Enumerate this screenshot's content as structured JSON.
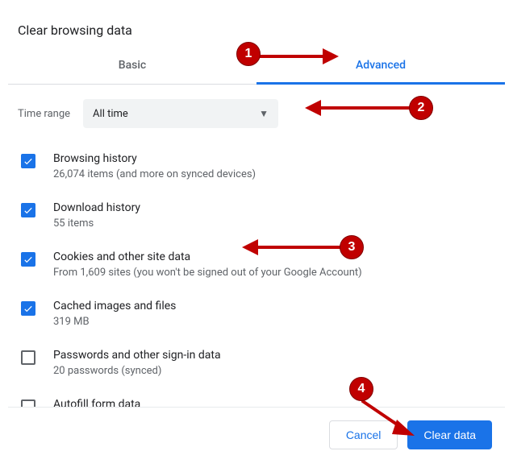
{
  "dialog_title": "Clear browsing data",
  "tabs": {
    "basic": "Basic",
    "advanced": "Advanced"
  },
  "time": {
    "label": "Time range",
    "value": "All time"
  },
  "items": [
    {
      "title": "Browsing history",
      "sub": "26,074 items (and more on synced devices)",
      "checked": true
    },
    {
      "title": "Download history",
      "sub": "55 items",
      "checked": true
    },
    {
      "title": "Cookies and other site data",
      "sub": "From 1,609 sites (you won't be signed out of your Google Account)",
      "checked": true
    },
    {
      "title": "Cached images and files",
      "sub": "319 MB",
      "checked": true
    },
    {
      "title": "Passwords and other sign-in data",
      "sub": "20 passwords (synced)",
      "checked": false
    },
    {
      "title": "Autofill form data",
      "sub": "",
      "checked": false
    }
  ],
  "buttons": {
    "cancel": "Cancel",
    "clear": "Clear data"
  },
  "annotations": {
    "n1": "1",
    "n2": "2",
    "n3": "3",
    "n4": "4"
  }
}
